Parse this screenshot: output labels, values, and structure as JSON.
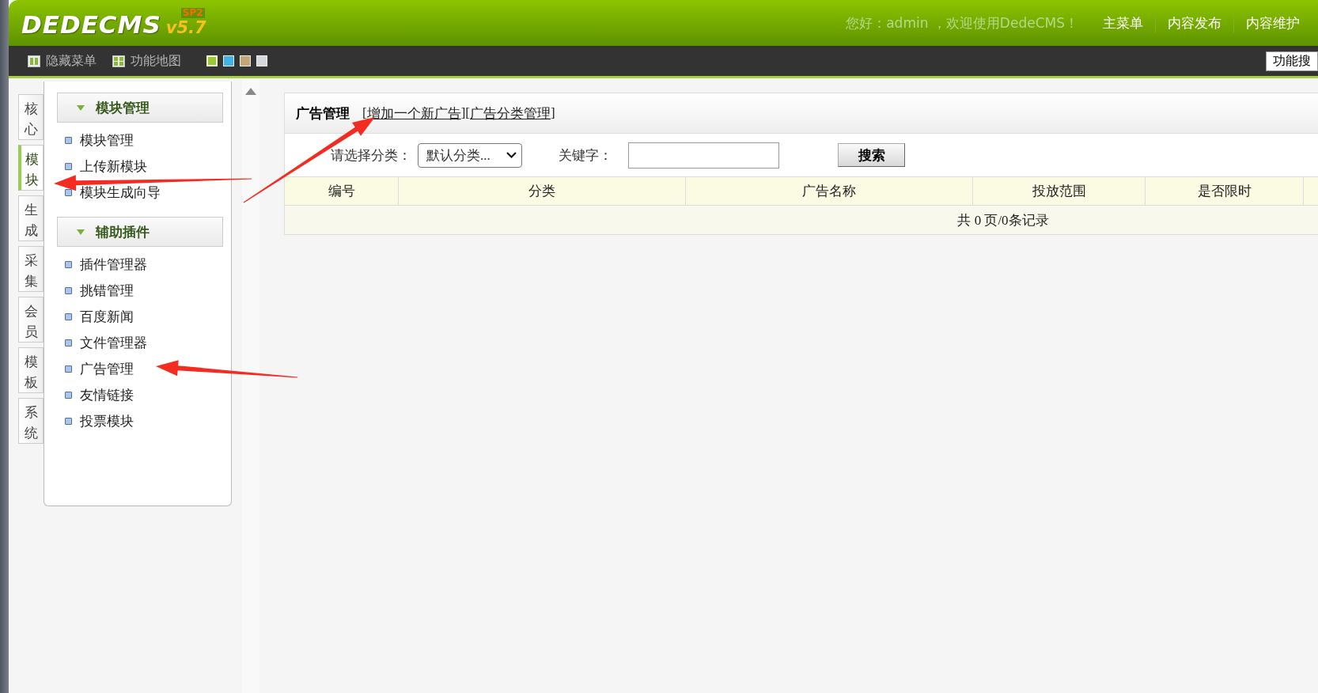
{
  "header": {
    "logo": {
      "brand": "DEDECMS",
      "version": "v5.7",
      "edition": "SP2"
    },
    "greeting": "您好：admin ，欢迎使用DedeCMS！",
    "nav": [
      {
        "label": "主菜单"
      },
      {
        "label": "内容发布"
      },
      {
        "label": "内容维护"
      }
    ]
  },
  "toolbar": {
    "items": [
      {
        "label": "隐藏菜单",
        "kind": "panel"
      },
      {
        "label": "功能地图",
        "kind": "grid"
      }
    ],
    "swatches": [
      {
        "color": "#9cc83c",
        "selected": true
      },
      {
        "color": "#3fb2e6",
        "selected": false
      },
      {
        "color": "#c2a878",
        "selected": false
      },
      {
        "color": "#d6d9dc",
        "selected": false
      }
    ],
    "search_button": "功能搜"
  },
  "side_tabs": [
    {
      "label": "核心",
      "selected": false
    },
    {
      "label": "模块",
      "selected": true
    },
    {
      "label": "生成",
      "selected": false
    },
    {
      "label": "采集",
      "selected": false
    },
    {
      "label": "会员",
      "selected": false
    },
    {
      "label": "模板",
      "selected": false
    },
    {
      "label": "系统",
      "selected": false
    }
  ],
  "menu": {
    "groups": [
      {
        "title": "模块管理",
        "expanded": true,
        "items": [
          "模块管理",
          "上传新模块",
          "模块生成向导"
        ]
      },
      {
        "title": "辅助插件",
        "expanded": true,
        "items": [
          "插件管理器",
          "挑错管理",
          "百度新闻",
          "文件管理器",
          "广告管理",
          "友情链接",
          "投票模块"
        ]
      }
    ]
  },
  "content": {
    "title": "广告管理",
    "links": [
      {
        "prefix": "[",
        "label": "增加一个新广告",
        "suffix": "]"
      },
      {
        "prefix": "[",
        "label": "广告分类管理",
        "suffix": "]"
      }
    ],
    "filter": {
      "category_label": "请选择分类：",
      "category_value": "默认分类...",
      "keyword_label": "关键字：",
      "search_button": "搜索"
    },
    "table": {
      "columns": [
        "编号",
        "分类",
        "广告名称",
        "投放范围",
        "是否限时"
      ],
      "footer": "共 0 页/0条记录"
    }
  }
}
